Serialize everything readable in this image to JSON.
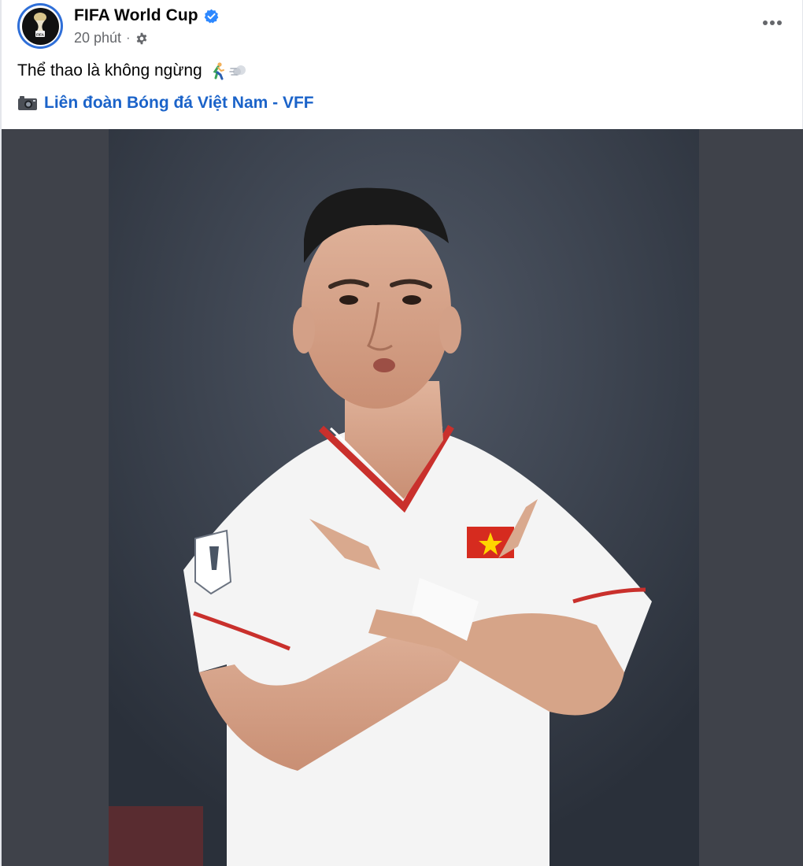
{
  "post": {
    "page_name": "FIFA World Cup",
    "time": "20 phút",
    "separator": "·",
    "caption": "Thể thao là không ngừng",
    "credit_link": "Liên đoàn Bóng đá Việt Nam - VFF"
  },
  "icons": {
    "verified": "verified-badge-icon",
    "audience": "gear-icon",
    "more": "more-options-icon",
    "caption_emoji": [
      "running-person-icon",
      "dash-icon"
    ],
    "credit": "camera-icon"
  },
  "colors": {
    "link": "#1b63c9",
    "verified": "#2d88ff",
    "meta": "#65676b",
    "photo_backdrop": "#3f424a",
    "jersey": "#f4f4f4",
    "jersey_trim": "#c9302c",
    "flag_red": "#d62b1f",
    "flag_star": "#ffd500"
  }
}
